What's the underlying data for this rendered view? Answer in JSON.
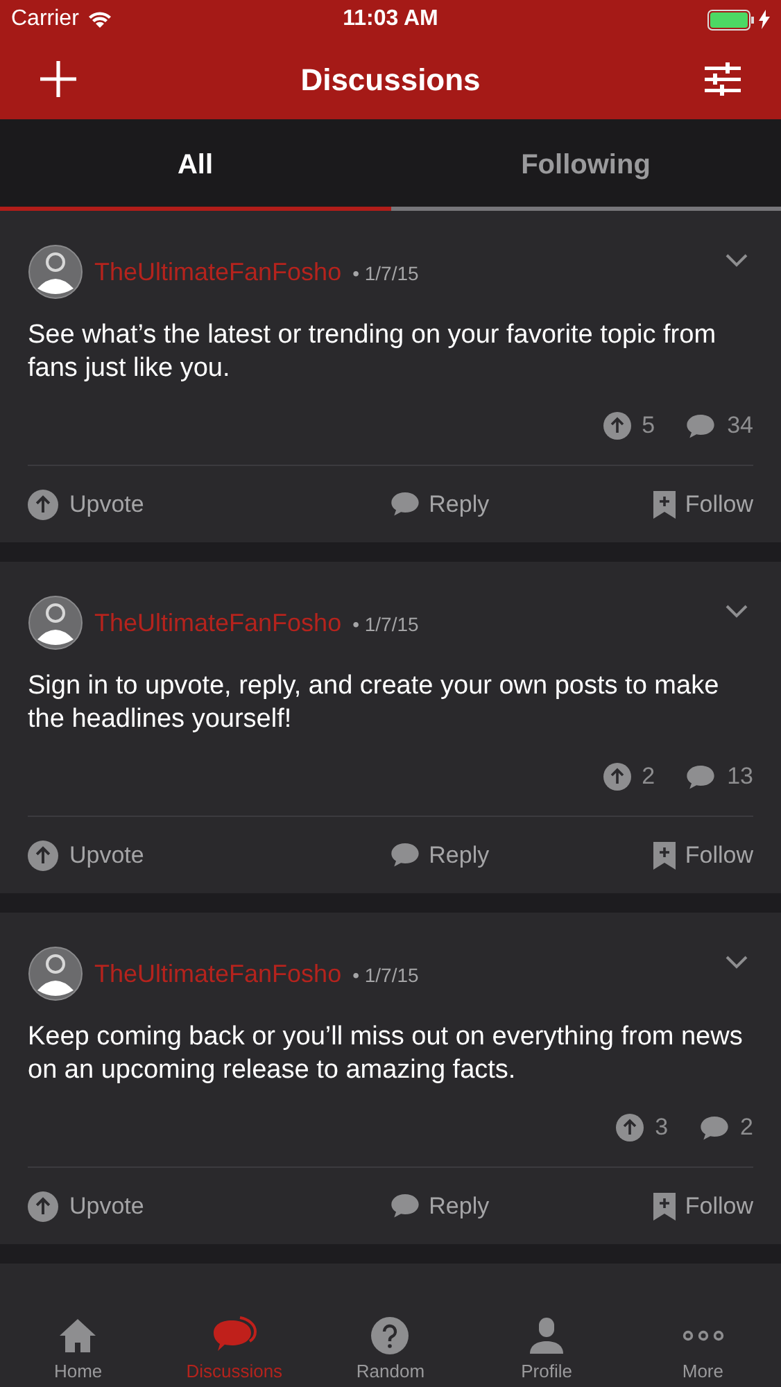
{
  "status_bar": {
    "carrier": "Carrier",
    "time": "11:03 AM"
  },
  "nav": {
    "title": "Discussions"
  },
  "tabs": [
    {
      "label": "All",
      "selected": true
    },
    {
      "label": "Following",
      "selected": false
    }
  ],
  "posts": [
    {
      "author": "TheUltimateFanFosho",
      "date": "• 1/7/15",
      "body": "See what’s the latest or trending on your favorite topic from fans just like you.",
      "upvotes": "5",
      "replies": "34",
      "actions": {
        "upvote": "Upvote",
        "reply": "Reply",
        "follow": "Follow"
      }
    },
    {
      "author": "TheUltimateFanFosho",
      "date": "• 1/7/15",
      "body": "Sign in to upvote, reply, and create your own posts to make the headlines yourself!",
      "upvotes": "2",
      "replies": "13",
      "actions": {
        "upvote": "Upvote",
        "reply": "Reply",
        "follow": "Follow"
      }
    },
    {
      "author": "TheUltimateFanFosho",
      "date": "• 1/7/15",
      "body": "Keep coming back or you’ll miss out on everything from news on an upcoming release to amazing facts.",
      "upvotes": "3",
      "replies": "2",
      "actions": {
        "upvote": "Upvote",
        "reply": "Reply",
        "follow": "Follow"
      }
    }
  ],
  "tab_bar": [
    {
      "kind": "home",
      "label": "Home",
      "selected": false
    },
    {
      "kind": "discussions",
      "label": "Discussions",
      "selected": true
    },
    {
      "kind": "random",
      "label": "Random",
      "selected": false
    },
    {
      "kind": "profile",
      "label": "Profile",
      "selected": false
    },
    {
      "kind": "more",
      "label": "More",
      "selected": false
    }
  ]
}
